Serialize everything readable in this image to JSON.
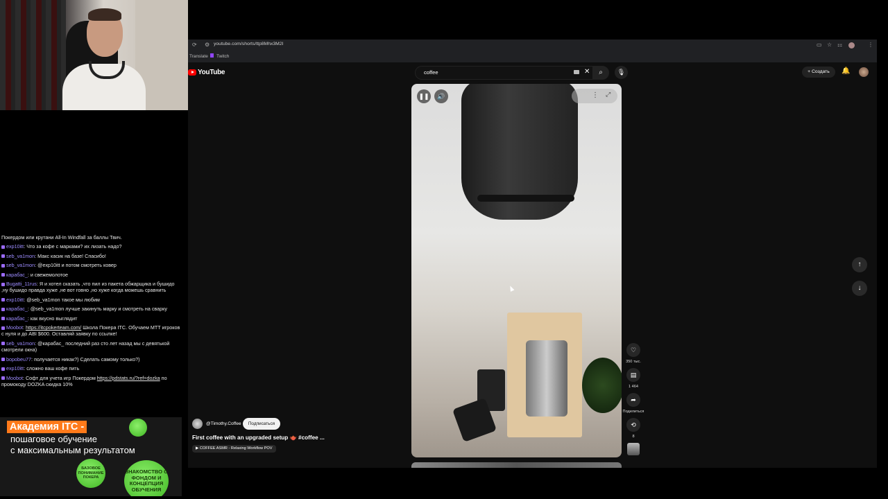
{
  "browser": {
    "url": "youtube.com/shorts/ttp8Mhx3M2I",
    "bookmarks": [
      "Translate",
      "Twitch"
    ]
  },
  "youtube": {
    "logo_text": "YouTube",
    "search": {
      "value": "coffee"
    },
    "create_label": "Создать"
  },
  "short": {
    "channel": "@Timothy.Coffee",
    "subscribe_label": "Подписаться",
    "title": "First coffee with an upgraded setup 🫖 #coffee ...",
    "playlist": "▶ COFFEE ASMR - Relaxing Workflow POV",
    "actions": {
      "likes": "350 тыс.",
      "comments": "1 464",
      "share": "Поделиться",
      "remix": "8"
    }
  },
  "chat": [
    {
      "user": "",
      "text": "Покердом или крутани All-In Windfall за баллы Твич."
    },
    {
      "user": "exp10itt",
      "text": "Что за кофе с марками? их лизать надо?"
    },
    {
      "user": "seb_va1mon",
      "text": "Макс касик на базе! Спасибо!"
    },
    {
      "user": "seb_va1mon",
      "text": "@exp10itt и потом смотреть ковер"
    },
    {
      "user": "карабас_",
      "text": "и свежемолотое"
    },
    {
      "user": "Bugatti_11rus",
      "text": "Я и хотел сказать ,что пил из пакета обжарщика и бушидо ,ну бушидо правда хуже ,не вот говно ,но хуже когда можешь сравнить"
    },
    {
      "user": "exp10itt",
      "text": "@seb_va1mon такое мы любим"
    },
    {
      "user": "карабас_",
      "text": "@seb_va1mon лучше закинуть марку и смотреть на сварку"
    },
    {
      "user": "карабас_",
      "text": "как вкусно выглядит"
    },
    {
      "user": "Moobot",
      "link": "https://itcpokerteam.com/",
      "text": " Школа Покера ITC. Обучаем МТТ игроков с нуля и до ABI $600. Оставляй заявку по ссылке!"
    },
    {
      "user": "seb_va1mon",
      "text": "@карабас_ последний раз сто лет назад мы с девятькой смотрели окна)"
    },
    {
      "user": "bopobeu77",
      "text": "получается никак?) Сделать самому только?)"
    },
    {
      "user": "exp10itt",
      "text": "сложно ваш кофе пить"
    },
    {
      "user": "Moobot",
      "prefix": "Софт для учета игр Покердом ",
      "link": "https://pdstats.ru/?ref=dozka",
      "text": " по промокоду DOZKA скидка 10%"
    }
  ],
  "promo": {
    "title": "Академия ITC -",
    "subtitle_1": "пошаговое обучение",
    "subtitle_2": "с максимальным результатом",
    "circle_1": "БАЗОВОЕ ПОНИМАНИЕ ПОКЕРА",
    "circle_2": "ЗНАКОМСТВО С ФОНДОМ И КОНЦЕПЦИЯ ОБУЧЕНИЯ"
  }
}
